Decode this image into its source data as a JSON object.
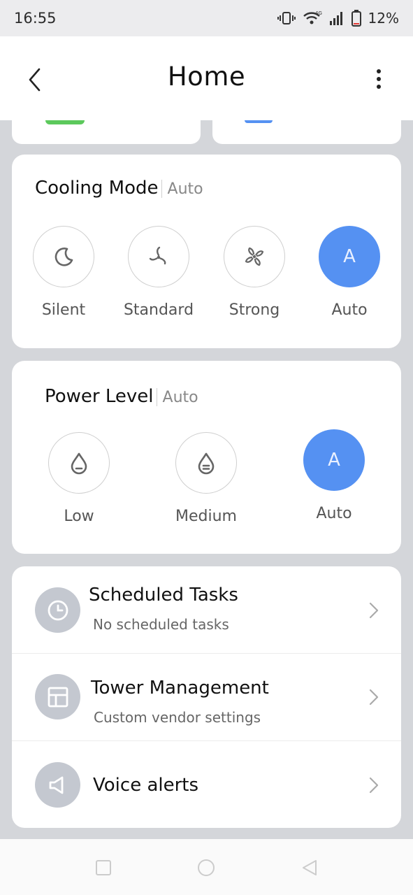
{
  "status_bar": {
    "time": "16:55",
    "network": "4G",
    "battery_percent": "12%",
    "battery_level": 0.12,
    "battery_color": "#e53935"
  },
  "header": {
    "title": "Home",
    "back_icon": "chevron-left-icon",
    "more_icon": "more-vertical-icon"
  },
  "cooling_mode": {
    "title": "Cooling Mode",
    "current": "Auto",
    "options": [
      {
        "label": "Silent",
        "icon": "moon-icon",
        "selected": false
      },
      {
        "label": "Standard",
        "icon": "fan-icon",
        "selected": false
      },
      {
        "label": "Strong",
        "icon": "fan-strong-icon",
        "selected": false
      },
      {
        "label": "Auto",
        "icon_text": "A",
        "selected": true
      }
    ]
  },
  "power_level": {
    "title": "Power Level",
    "current": "Auto",
    "options": [
      {
        "label": "Low",
        "icon": "drop-low-icon",
        "selected": false
      },
      {
        "label": "Medium",
        "icon": "drop-medium-icon",
        "selected": false
      },
      {
        "label": "Auto",
        "icon_text": "A",
        "selected": true
      }
    ]
  },
  "menu_list": [
    {
      "title": "Scheduled Tasks",
      "subtitle": "No scheduled tasks",
      "icon": "clock-icon"
    },
    {
      "title": "Tower Management",
      "subtitle": "Custom vendor settings",
      "icon": "layout-icon"
    },
    {
      "title": "Voice alerts",
      "icon": "speaker-icon"
    }
  ],
  "colors": {
    "accent": "#5591f2",
    "page_background": "#d4d6da",
    "icon_circle": "#c4c8d0"
  },
  "nav_bar": {
    "icons": [
      "recent-apps-icon",
      "home-icon",
      "back-icon"
    ]
  }
}
